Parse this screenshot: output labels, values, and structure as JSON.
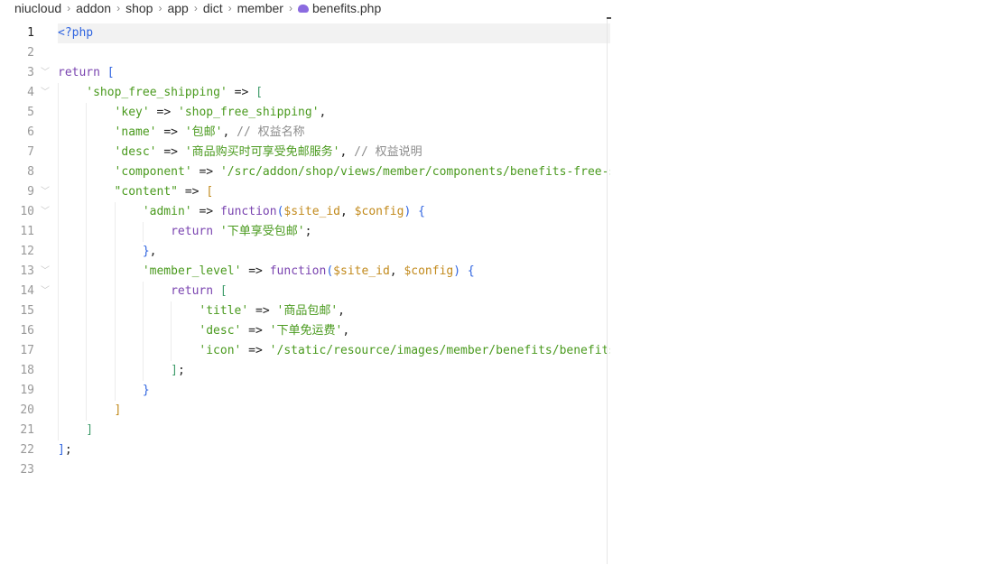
{
  "breadcrumb": [
    "niucloud",
    "addon",
    "shop",
    "app",
    "dict",
    "member"
  ],
  "file": {
    "name": "benefits.php",
    "icon": "php-elephant-icon",
    "icon_color": "#8b6be0"
  },
  "active_line": 1,
  "lines": [
    {
      "n": "1",
      "indent": 0,
      "tokens": [
        [
          "t",
          "<?php"
        ]
      ]
    },
    {
      "n": "2",
      "indent": 0,
      "tokens": []
    },
    {
      "n": "3",
      "indent": 0,
      "fold": true,
      "tokens": [
        [
          "k",
          "return"
        ],
        [
          "o",
          " "
        ],
        [
          "b1",
          "["
        ]
      ]
    },
    {
      "n": "4",
      "indent": 1,
      "fold": true,
      "tokens": [
        [
          "s",
          "'shop_free_shipping'"
        ],
        [
          "o",
          " => "
        ],
        [
          "b2",
          "["
        ]
      ]
    },
    {
      "n": "5",
      "indent": 2,
      "tokens": [
        [
          "s",
          "'key'"
        ],
        [
          "o",
          " => "
        ],
        [
          "s",
          "'shop_free_shipping'"
        ],
        [
          "o",
          ","
        ]
      ]
    },
    {
      "n": "6",
      "indent": 2,
      "tokens": [
        [
          "s",
          "'name'"
        ],
        [
          "o",
          " => "
        ],
        [
          "s",
          "'包邮'"
        ],
        [
          "o",
          ", "
        ],
        [
          "c",
          "// 权益名称"
        ]
      ]
    },
    {
      "n": "7",
      "indent": 2,
      "tokens": [
        [
          "s",
          "'desc'"
        ],
        [
          "o",
          " => "
        ],
        [
          "s",
          "'商品购买时可享受免邮服务'"
        ],
        [
          "o",
          ", "
        ],
        [
          "c",
          "// 权益说明"
        ]
      ]
    },
    {
      "n": "8",
      "indent": 2,
      "tokens": [
        [
          "s",
          "'component'"
        ],
        [
          "o",
          " => "
        ],
        [
          "s",
          "'/src/addon/shop/views/member/components/benefits-free-shipping.vue',"
        ]
      ]
    },
    {
      "n": "9",
      "indent": 2,
      "fold": true,
      "tokens": [
        [
          "s",
          "\"content\""
        ],
        [
          "o",
          " => "
        ],
        [
          "b3",
          "["
        ]
      ]
    },
    {
      "n": "10",
      "indent": 3,
      "fold": true,
      "tokens": [
        [
          "s",
          "'admin'"
        ],
        [
          "o",
          " => "
        ],
        [
          "k",
          "function"
        ],
        [
          "b1",
          "("
        ],
        [
          "v",
          "$site_id"
        ],
        [
          "o",
          ", "
        ],
        [
          "v",
          "$config"
        ],
        [
          "b1",
          ")"
        ],
        [
          "o",
          " "
        ],
        [
          "b1",
          "{"
        ]
      ]
    },
    {
      "n": "11",
      "indent": 4,
      "tokens": [
        [
          "k",
          "return"
        ],
        [
          "o",
          " "
        ],
        [
          "s",
          "'下单享受包邮'"
        ],
        [
          "o",
          ";"
        ]
      ]
    },
    {
      "n": "12",
      "indent": 3,
      "tokens": [
        [
          "b1",
          "}"
        ],
        [
          "o",
          ","
        ]
      ]
    },
    {
      "n": "13",
      "indent": 3,
      "fold": true,
      "tokens": [
        [
          "s",
          "'member_level'"
        ],
        [
          "o",
          " => "
        ],
        [
          "k",
          "function"
        ],
        [
          "b1",
          "("
        ],
        [
          "v",
          "$site_id"
        ],
        [
          "o",
          ", "
        ],
        [
          "v",
          "$config"
        ],
        [
          "b1",
          ")"
        ],
        [
          "o",
          " "
        ],
        [
          "b1",
          "{"
        ]
      ]
    },
    {
      "n": "14",
      "indent": 4,
      "fold": true,
      "tokens": [
        [
          "k",
          "return"
        ],
        [
          "o",
          " "
        ],
        [
          "b2",
          "["
        ]
      ]
    },
    {
      "n": "15",
      "indent": 5,
      "tokens": [
        [
          "s",
          "'title'"
        ],
        [
          "o",
          " => "
        ],
        [
          "s",
          "'商品包邮'"
        ],
        [
          "o",
          ","
        ]
      ]
    },
    {
      "n": "16",
      "indent": 5,
      "tokens": [
        [
          "s",
          "'desc'"
        ],
        [
          "o",
          " => "
        ],
        [
          "s",
          "'下单免运费'"
        ],
        [
          "o",
          ","
        ]
      ]
    },
    {
      "n": "17",
      "indent": 5,
      "tokens": [
        [
          "s",
          "'icon'"
        ],
        [
          "o",
          " => "
        ],
        [
          "s",
          "'/static/resource/images/member/benefits/benefits_free_shipping.png'"
        ]
      ]
    },
    {
      "n": "18",
      "indent": 4,
      "tokens": [
        [
          "b2",
          "]"
        ],
        [
          "o",
          ";"
        ]
      ]
    },
    {
      "n": "19",
      "indent": 3,
      "tokens": [
        [
          "b1",
          "}"
        ]
      ]
    },
    {
      "n": "20",
      "indent": 2,
      "tokens": [
        [
          "b3",
          "]"
        ]
      ]
    },
    {
      "n": "21",
      "indent": 1,
      "tokens": [
        [
          "b2",
          "]"
        ]
      ]
    },
    {
      "n": "22",
      "indent": 0,
      "tokens": [
        [
          "b1",
          "]"
        ],
        [
          "o",
          ";"
        ]
      ]
    },
    {
      "n": "23",
      "indent": 0,
      "tokens": []
    }
  ]
}
